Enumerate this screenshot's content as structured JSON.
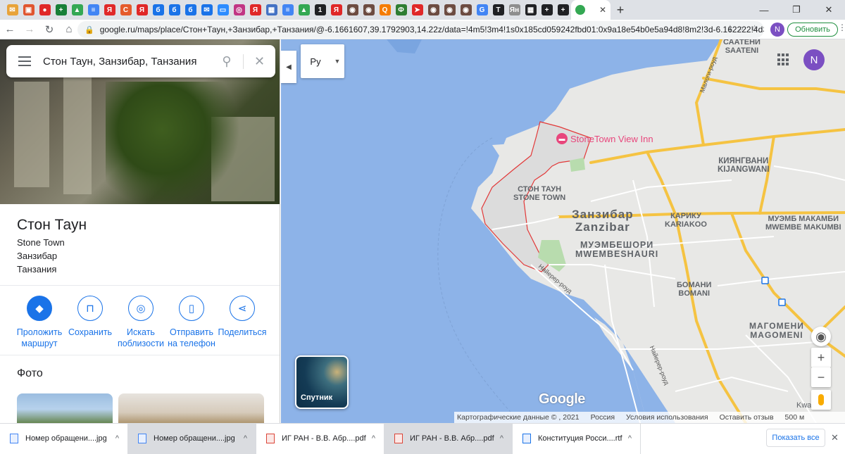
{
  "browser": {
    "tab_icon_colors": [
      "#e8a33a",
      "#e0552f",
      "#e02828",
      "#188038",
      "#34a853",
      "#4285f4",
      "#e02828",
      "#e55a2b",
      "#e02828",
      "#1a73e8",
      "#1a73e8",
      "#1a73e8",
      "#1a73e8",
      "#2d8cff",
      "#c13584",
      "#e02828",
      "#4472c4",
      "#4285f4",
      "#34a853",
      "#202124",
      "#e02828",
      "#6d4c41",
      "#6d4c41",
      "#f57c00",
      "#2e7d32",
      "#e02828",
      "#6d4c41",
      "#6d4c41",
      "#6d4c41",
      "#4285f4",
      "#202124",
      "#8e8e8e",
      "#202124",
      "#202124",
      "#202124"
    ],
    "tab_icon_glyphs": [
      "✉",
      "▣",
      "●",
      "+",
      "▲",
      "≡",
      "Я",
      "С",
      "Я",
      "б",
      "б",
      "б",
      "✉",
      "▭",
      "◎",
      "Я",
      "▦",
      "≡",
      "▲",
      "1",
      "Я",
      "◉",
      "◉",
      "Q",
      "Ф",
      "➤",
      "◉",
      "◉",
      "◉",
      "G",
      "T",
      "Ян",
      "▦",
      "+",
      "+"
    ],
    "new_tab": "+",
    "url": "google.ru/maps/place/Стон+Таун,+Занзибар,+Танзания/@-6.1661607,39.1792903,14.22z/data=!4m5!3m4!1s0x185cd059242fbd01:0x9a18e54b0e5a94d8!8m2!3d-6.162222!4d39...",
    "profile_initial": "N",
    "update_label": "Обновить"
  },
  "search": {
    "value": "Стон Таун, Занзибар, Танзания"
  },
  "place": {
    "title": "Стон Таун",
    "line1": "Stone Town",
    "line2": "Занзибар",
    "line3": "Танзания"
  },
  "actions": [
    {
      "label": "Проложить маршрут"
    },
    {
      "label": "Сохранить"
    },
    {
      "label": "Искать поблизости"
    },
    {
      "label": "Отправить на телефон"
    },
    {
      "label": "Поделиться"
    }
  ],
  "photos_heading": "Фото",
  "map": {
    "language_button": "Ру",
    "avatar_initial": "N",
    "satellite_label": "Спутник",
    "poi_name": "StoneTown View Inn",
    "labels": {
      "saateni_ru": "СААТЕНИ",
      "saateni_en": "SAATENI",
      "kiyangwani_ru": "КИЯНГВАНИ",
      "kiyangwani_en": "KIJANGWANI",
      "stone_town_ru": "СТОН ТАУН",
      "stone_town_en": "STONE TOWN",
      "zanzibar_ru": "Занзибар",
      "zanzibar_en": "Zanzibar",
      "kariakoo_ru": "КАРИКУ",
      "kariakoo_en": "KARIAKOO",
      "mwembe_makumbi_ru": "МУЭМБ МАКАМБИ",
      "mwembe_makumbi_en": "MWEMBE MAKUMBI",
      "mwembeshauri_ru": "МУЭМБЕШОРИ",
      "mwembeshauri_en": "MWEMBESHAURI",
      "bomani_ru": "БОМАНИ",
      "bomani_en": "BOMANI",
      "magomeni_ru": "МАГОМЕНИ",
      "magomeni_en": "MAGOMENI",
      "kwamchi": "Kwa Mchi",
      "road_maloni": "Малоги-роуд",
      "road_nyerere1": "Найерер-роуд",
      "road_nyerere2": "Найерер-роуд"
    },
    "attribution": {
      "data": "Картографические данные © , 2021",
      "country": "Россия",
      "terms": "Условия использования",
      "feedback": "Оставить отзыв",
      "scale": "500 м"
    },
    "google_logo": "Google",
    "colors": {
      "water": "#8db3e8",
      "land": "#e8e8e6",
      "road": "#f5c342",
      "boundary": "#e23838"
    }
  },
  "downloads": [
    {
      "name": "Номер обращени....jpg",
      "type": "jpg"
    },
    {
      "name": "Номер обращени....jpg",
      "type": "jpg"
    },
    {
      "name": "ИГ РАН - В.В. Абр....pdf",
      "type": "pdf"
    },
    {
      "name": "ИГ РАН - В.В. Абр....pdf",
      "type": "pdf"
    },
    {
      "name": "Конституция Росси....rtf",
      "type": "rtf"
    }
  ],
  "show_all": "Показать все"
}
